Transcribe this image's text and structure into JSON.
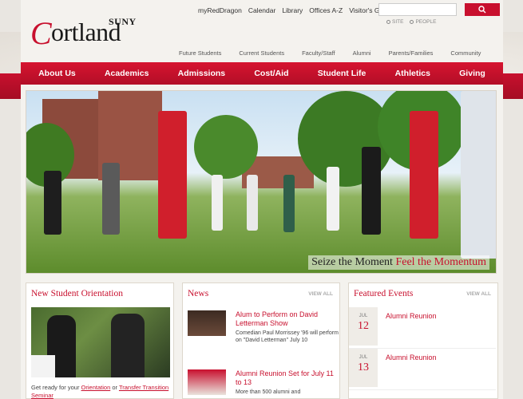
{
  "logo": {
    "system": "SUNY",
    "c": "C",
    "name": "ortland"
  },
  "utility_links": [
    "myRedDragon",
    "Calendar",
    "Library",
    "Offices A-Z",
    "Visitor's Guide"
  ],
  "search": {
    "placeholder": "",
    "scope_site": "SITE",
    "scope_people": "PEOPLE"
  },
  "audience_links": [
    "Future Students",
    "Current Students",
    "Faculty/Staff",
    "Alumni",
    "Parents/Families",
    "Community"
  ],
  "main_nav": [
    "About Us",
    "Academics",
    "Admissions",
    "Cost/Aid",
    "Student Life",
    "Athletics",
    "Giving"
  ],
  "hero": {
    "caption_dark": "Seize the Moment",
    "caption_accent": "Feel the Momentum"
  },
  "orientation": {
    "title": "New Student Orientation",
    "text_before": "Get ready for your",
    "link1": "Orientation",
    "text_mid": "or",
    "link2": "Transfer Transition Seminar"
  },
  "news": {
    "title": "News",
    "view_all": "VIEW ALL",
    "items": [
      {
        "headline": "Alum to Perform on David Letterman Show",
        "desc": "Comedian Paul Morrissey '96 will perform on \"David Letterman\" July 10"
      },
      {
        "headline": "Alumni Reunion Set for July 11 to 13",
        "desc": "More than 500 alumni and"
      }
    ]
  },
  "events": {
    "title": "Featured Events",
    "view_all": "VIEW ALL",
    "items": [
      {
        "month": "JUL",
        "day": "12",
        "title": "Alumni Reunion"
      },
      {
        "month": "JUL",
        "day": "13",
        "title": "Alumni Reunion"
      }
    ]
  },
  "colors": {
    "brand_red": "#c8102e"
  }
}
